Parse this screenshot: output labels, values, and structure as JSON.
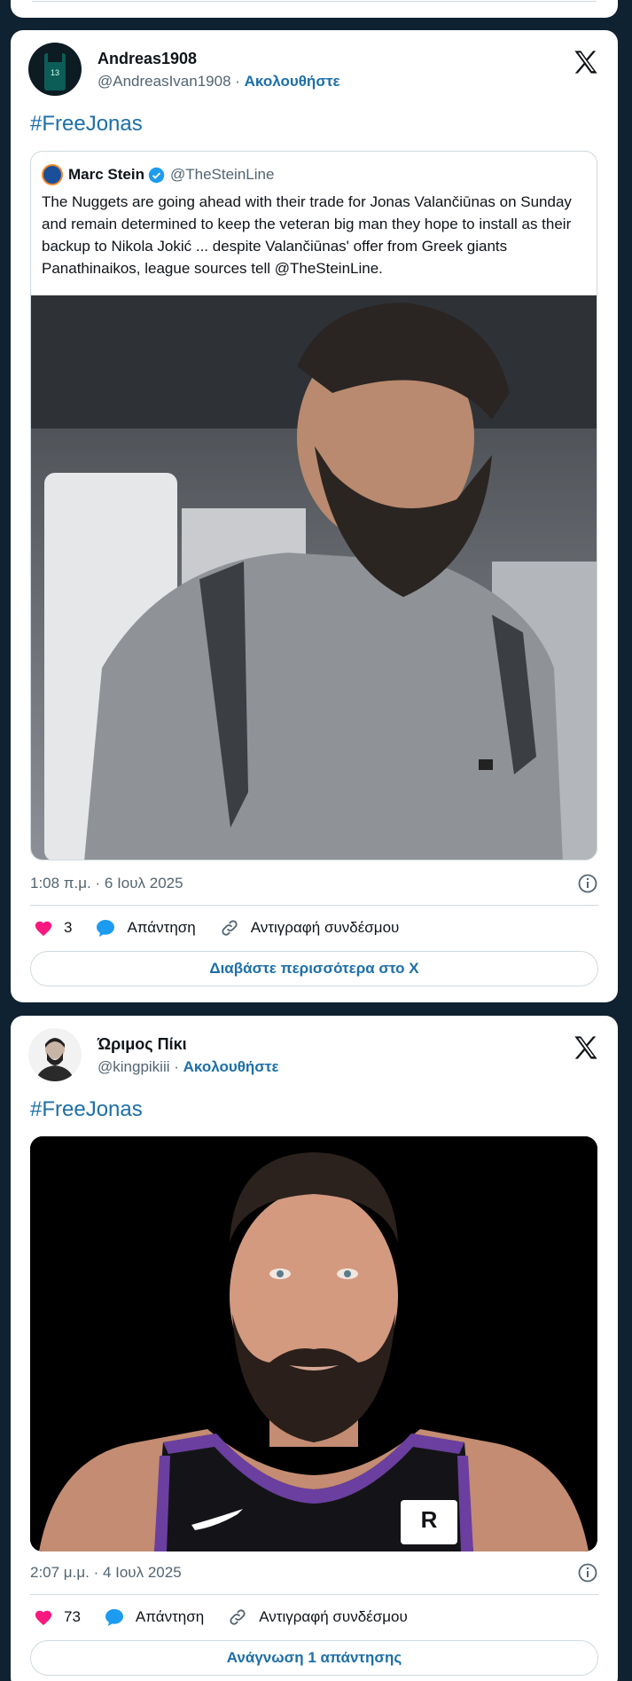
{
  "tweets": [
    {
      "display_name": "Andreas1908",
      "handle": "@AndreasIvan1908",
      "follow_label": "Ακολουθήστε",
      "hashtag": "#FreeJonas",
      "quote": {
        "name": "Marc Stein",
        "handle": "@TheSteinLine",
        "text": "The Nuggets are going ahead with their trade for Jonas Valančiūnas on Sunday and remain determined to keep the veteran big man they hope to install as their backup to Nikola Jokić ... despite Valančiūnas' offer from Greek giants Panathinaikos, league sources tell @TheSteinLine."
      },
      "timestamp": "1:08 π.μ. · 6 Ιουλ 2025",
      "likes": "3",
      "reply_label": "Απάντηση",
      "copy_link_label": "Αντιγραφή συνδέσμου",
      "more_label": "Διαβάστε περισσότερα στο X"
    },
    {
      "display_name": "Ώριμος Πίκι",
      "handle": "@kingpikiii",
      "follow_label": "Ακολουθήστε",
      "hashtag": "#FreeJonas",
      "timestamp": "2:07 μ.μ. · 4 Ιουλ 2025",
      "likes": "73",
      "reply_label": "Απάντηση",
      "copy_link_label": "Αντιγραφή συνδέσμου",
      "more_label": "Ανάγνωση 1 απάντησης"
    }
  ],
  "colors": {
    "background": "#0f2232",
    "link": "#1d6fa8",
    "like": "#f91880",
    "reply": "#1d9bf0"
  },
  "icons": [
    "x-logo-icon",
    "verified-badge-icon",
    "info-icon",
    "heart-icon",
    "speech-bubble-icon",
    "link-icon"
  ]
}
